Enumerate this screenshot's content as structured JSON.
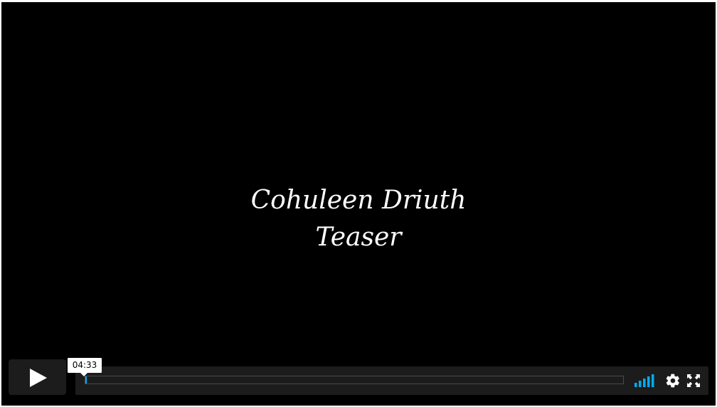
{
  "video": {
    "title_line1": "Cohuleen Driuth",
    "title_line2": "Teaser"
  },
  "controls": {
    "play_icon": "play-icon",
    "hover_time": "04:33",
    "progress_fraction": 0.002,
    "volume_icon": "volume-bars-icon",
    "settings_icon": "gear-icon",
    "fullscreen_icon": "fullscreen-icon"
  },
  "colors": {
    "accent": "#00adef",
    "background": "#000000",
    "control_bg": "#1c1c1c",
    "text": "#ffffff"
  }
}
